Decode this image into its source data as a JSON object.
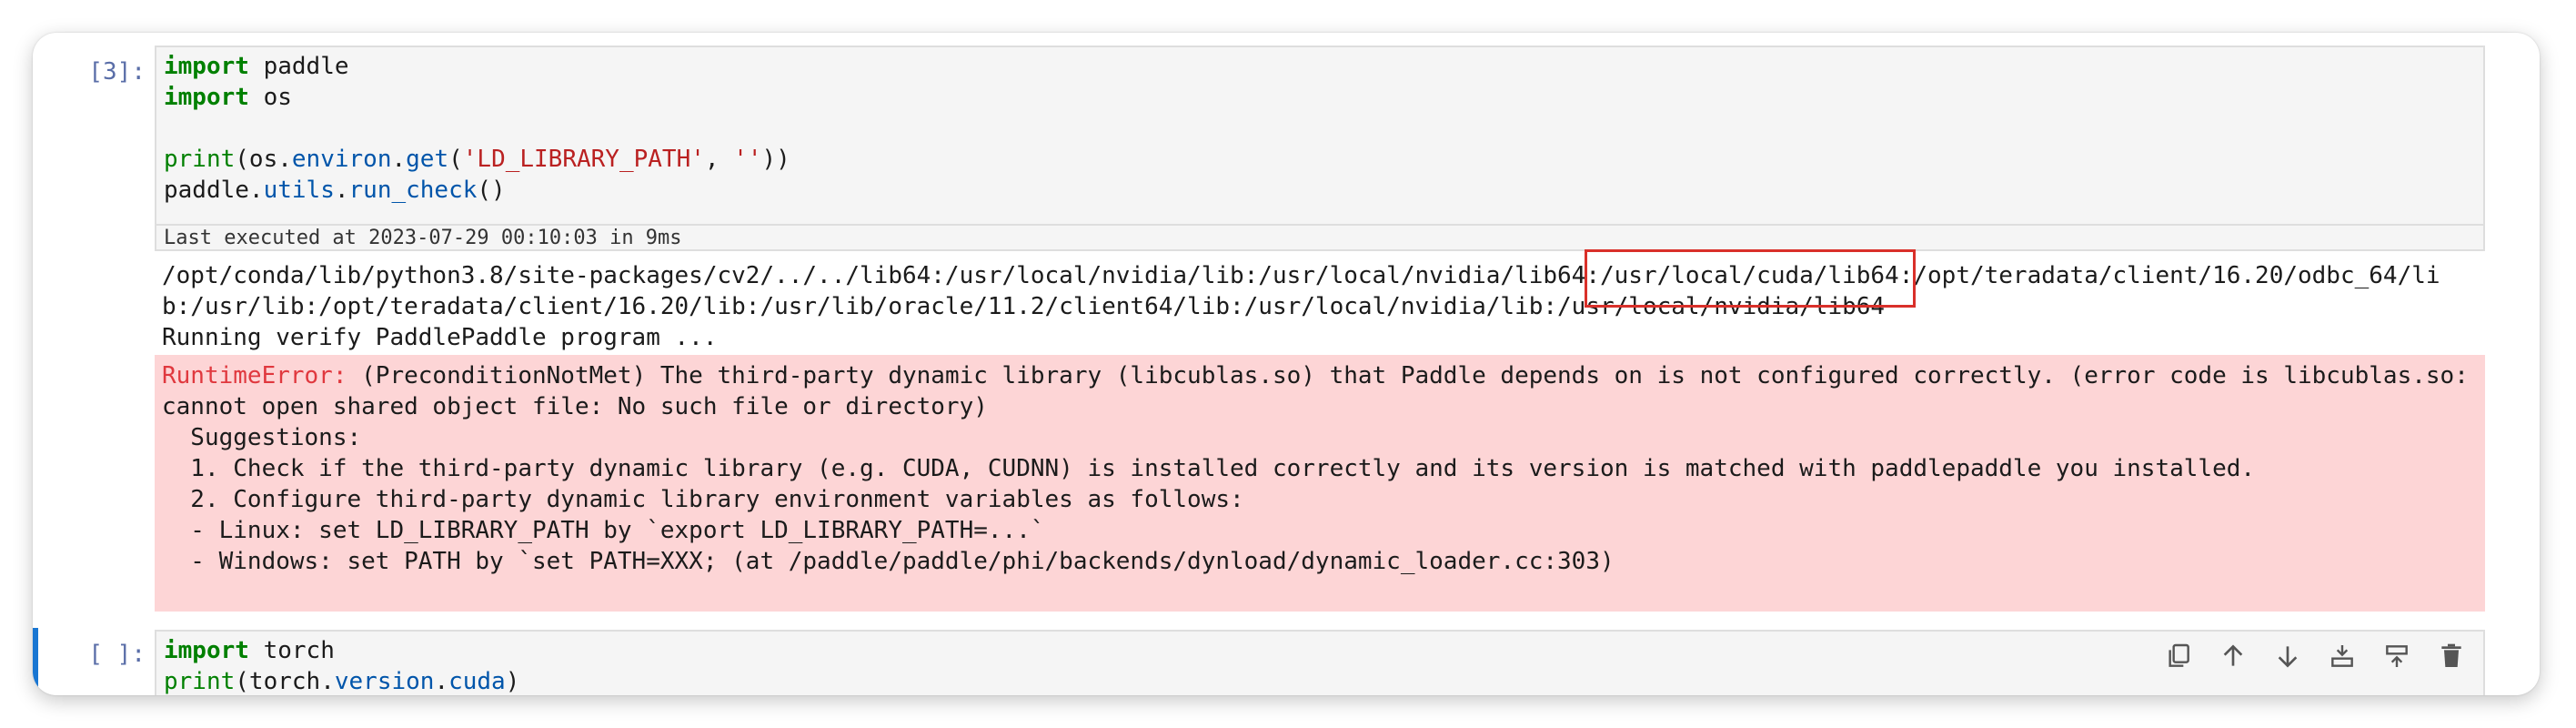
{
  "cell1": {
    "prompt": "[3]:",
    "code": {
      "l1_kw": "import",
      "l1_rest": " paddle",
      "l2_kw": "import",
      "l2_rest": " os",
      "l4_fn": "print",
      "l4_a": "(os.",
      "l4_attr1": "environ",
      "l4_b": ".",
      "l4_attr2": "get",
      "l4_c": "(",
      "l4_str1": "'LD_LIBRARY_PATH'",
      "l4_d": ", ",
      "l4_str2": "''",
      "l4_e": "))",
      "l5_a": "paddle.",
      "l5_attr1": "utils",
      "l5_b": ".",
      "l5_attr2": "run_check",
      "l5_c": "()"
    },
    "exec_status": "Last executed at 2023-07-29 00:10:03 in 9ms",
    "output": {
      "path_line1": "/opt/conda/lib/python3.8/site-packages/cv2/../../lib64:/usr/local/nvidia/lib:/usr/local/nvidia/lib64:/usr/local/cuda/lib64:/opt/teradata/client/16.20/odbc_64/li",
      "path_line2": "b:/usr/lib:/opt/teradata/client/16.20/lib:/usr/lib/oracle/11.2/client64/lib:/usr/local/nvidia/lib:/usr/local/nvidia/lib64",
      "verify_line": "Running verify PaddlePaddle program ..."
    },
    "error": {
      "name": "RuntimeError:",
      "line1_rest": " (PreconditionNotMet) The third-party dynamic library (libcublas.so) that Paddle depends on is not configured correctly. (error code is libcublas.so:",
      "line2": "cannot open shared object file: No such file or directory)",
      "line3": "  Suggestions:",
      "line4": "  1. Check if the third-party dynamic library (e.g. CUDA, CUDNN) is installed correctly and its version is matched with paddlepaddle you installed.",
      "line5": "  2. Configure third-party dynamic library environment variables as follows:",
      "line6": "  - Linux: set LD_LIBRARY_PATH by `export LD_LIBRARY_PATH=...`",
      "line7": "  - Windows: set PATH by `set PATH=XXX; (at /paddle/paddle/phi/backends/dynload/dynamic_loader.cc:303)"
    }
  },
  "cell2": {
    "prompt": "[ ]:",
    "code": {
      "l1_kw": "import",
      "l1_rest": " torch",
      "l2_fn": "print",
      "l2_a": "(torch.",
      "l2_attr1": "version",
      "l2_b": ".",
      "l2_attr2": "cuda",
      "l2_c": ")"
    }
  },
  "toolbar": {
    "icons": [
      "duplicate-icon",
      "move-up-icon",
      "move-down-icon",
      "insert-above-icon",
      "insert-below-icon",
      "delete-icon"
    ]
  },
  "colors": {
    "keyword": "#008000",
    "attribute": "#0055aa",
    "string": "#ba2121",
    "error_name": "#e0383e",
    "error_bg": "#fdd5d6",
    "active_bar": "#1976d2",
    "highlight": "#d9302a"
  }
}
